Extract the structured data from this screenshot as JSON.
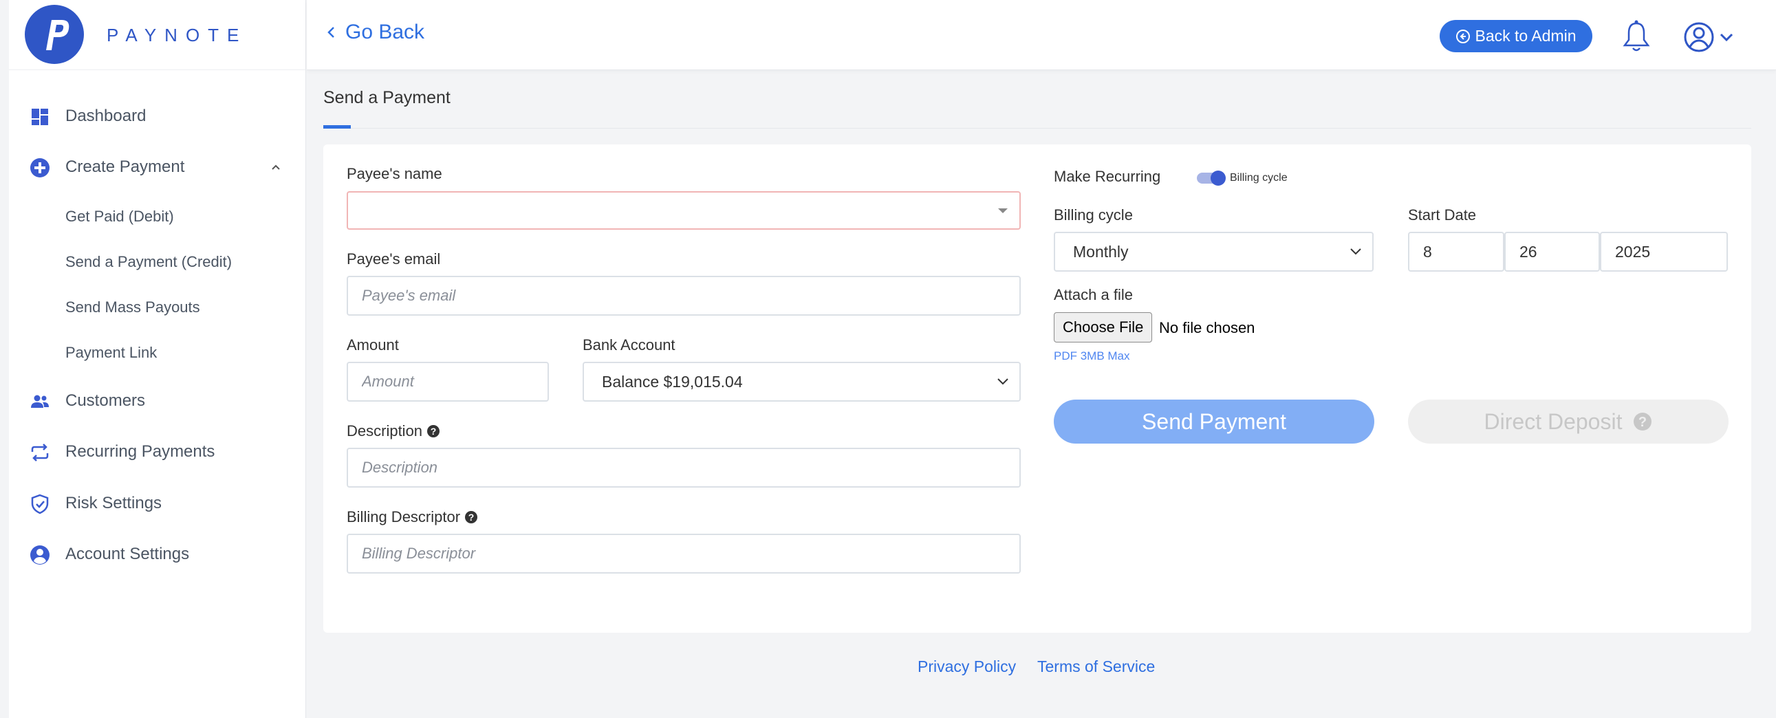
{
  "brand": {
    "name": "PAYNOTE",
    "color": "#2f56c6"
  },
  "sidebar": {
    "items": [
      {
        "label": "Dashboard",
        "icon": "dashboard-icon"
      },
      {
        "label": "Create Payment",
        "icon": "plus-circle-icon",
        "expanded": true,
        "children": [
          {
            "label": "Get Paid (Debit)"
          },
          {
            "label": "Send a Payment (Credit)"
          },
          {
            "label": "Send Mass Payouts"
          },
          {
            "label": "Payment Link"
          }
        ]
      },
      {
        "label": "Customers",
        "icon": "users-icon"
      },
      {
        "label": "Recurring Payments",
        "icon": "repeat-icon"
      },
      {
        "label": "Risk Settings",
        "icon": "shield-check-icon"
      },
      {
        "label": "Account Settings",
        "icon": "user-circle-icon"
      }
    ]
  },
  "topbar": {
    "back_label": "Go Back",
    "admin_button": "Back to Admin"
  },
  "page": {
    "title": "Send a Payment"
  },
  "form": {
    "payee_name": {
      "label": "Payee's name",
      "value": ""
    },
    "payee_email": {
      "label": "Payee's email",
      "placeholder": "Payee's email"
    },
    "amount": {
      "label": "Amount",
      "placeholder": "Amount"
    },
    "bank_account": {
      "label": "Bank Account",
      "value": "Balance $19,015.04"
    },
    "description": {
      "label": "Description",
      "placeholder": "Description"
    },
    "billing_descriptor": {
      "label": "Billing Descriptor",
      "placeholder": "Billing Descriptor"
    },
    "make_recurring": {
      "label": "Make Recurring",
      "toggle_caption": "Billing cycle",
      "enabled": true
    },
    "billing_cycle": {
      "label": "Billing cycle",
      "value": "Monthly"
    },
    "start_date": {
      "label": "Start Date",
      "month": "8",
      "day": "26",
      "year": "2025"
    },
    "attach_file": {
      "label": "Attach a file",
      "button": "Choose File",
      "status": "No file chosen",
      "hint": "PDF 3MB Max"
    },
    "send_button": "Send Payment",
    "direct_deposit_button": "Direct Deposit"
  },
  "footer": {
    "privacy": "Privacy Policy",
    "terms": "Terms of Service"
  },
  "colors": {
    "accent": "#2f6fe0",
    "send_button_bg": "#82aef5",
    "disabled_bg": "#efefef",
    "error_border": "#f1b5b5"
  }
}
